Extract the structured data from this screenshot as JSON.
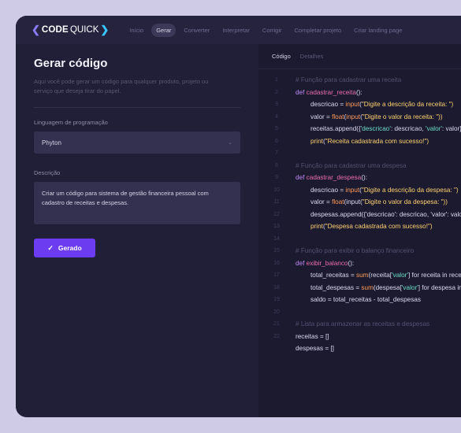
{
  "app": {
    "logo_text": "CODE",
    "logo_text2": "QUICK"
  },
  "nav": {
    "items": [
      "Início",
      "Gerar",
      "Converter",
      "Interpretar",
      "Corrigir",
      "Completar projeto",
      "Criar landing page"
    ],
    "active": "Gerar"
  },
  "form": {
    "title": "Gerar código",
    "subtitle": "Aqui você pode gerar um código para qualquer produto, projeto ou serviço que deseja tirar do papel.",
    "language_label": "Linguagem de programação",
    "language_value": "Phyton",
    "description_label": "Descrição",
    "description_value": "Criar um código para sistema de gestão financeira pessoal com cadastro de receitas e despesas.",
    "button_label": "Gerado"
  },
  "output": {
    "tabs": [
      "Código",
      "Detalhes"
    ],
    "active_tab": "Código",
    "line_numbers": [
      "1",
      "2",
      "3",
      "4",
      "5",
      "6",
      "7",
      "8",
      "9",
      "10",
      "11",
      "12",
      "13",
      "14",
      "15",
      "16",
      "17",
      "18",
      "19",
      "20",
      "21",
      "22"
    ],
    "code": {
      "c1": "# Função para cadastrar uma receita",
      "l2_kw": "def ",
      "l2_fn": "cadastrar_receita",
      "l2_rest": "():",
      "l3_a": "descricao = ",
      "l3_b": "input",
      "l3_c": "(",
      "l3_d": "\"Digite a descrição da receita: \")",
      "l4_a": "valor = ",
      "l4_b": "float",
      "l4_c": "(",
      "l4_d": "input",
      "l4_e": "(",
      "l4_f": "\"Digite o valor da receita: \"))",
      "l5_a": "receitas.append({",
      "l5_b": "'descricao'",
      "l5_c": ": descricao, ",
      "l5_d": "'valor'",
      "l5_e": ": valor})",
      "l6_a": "print",
      "l6_b": "(",
      "l6_c": "\"Receita cadastrada com sucesso!\")",
      "c8": "# Função para cadastrar uma despesa",
      "l9_kw": "def ",
      "l9_fn": "cadastrar_despesa",
      "l9_rest": "():",
      "l10_a": "descricao = ",
      "l10_b": "input",
      "l10_c": "(",
      "l10_d": "\"Digite a descrição da despesa: \")",
      "l11_a": "valor = ",
      "l11_b": "float",
      "l11_c": "(input(",
      "l11_d": "\"Digite o valor da despesa: \"))",
      "l12_a": "despesas.append({'descricao': descricao, 'valor': valor})",
      "l13_a": "print",
      "l13_b": "(",
      "l13_c": "\"Despesa cadastrada com sucesso!\")",
      "c15": "# Função para exibir o balanço financeiro",
      "l16_kw": "def ",
      "l16_fn": "exibir_balanco",
      "l16_rest": "():",
      "l17_a": "total_receitas = ",
      "l17_b": "sum",
      "l17_c": "(receita[",
      "l17_d": "'valor'",
      "l17_e": "] for receita in receitas)",
      "l18_a": "total_despesas = ",
      "l18_b": "sum",
      "l18_c": "(despesa[",
      "l18_d": "'valor'",
      "l18_e": "] for despesa in despesas)",
      "l19_a": "saldo = total_receitas - total_despesas",
      "c21": "# Lista para armazenar as receitas e despesas",
      "l22_a": "receitas = []",
      "l23_a": "despesas = []"
    }
  },
  "colors": {
    "accent": "#6c3cf0",
    "background": "#cfcbe6",
    "panel": "#211f37"
  }
}
